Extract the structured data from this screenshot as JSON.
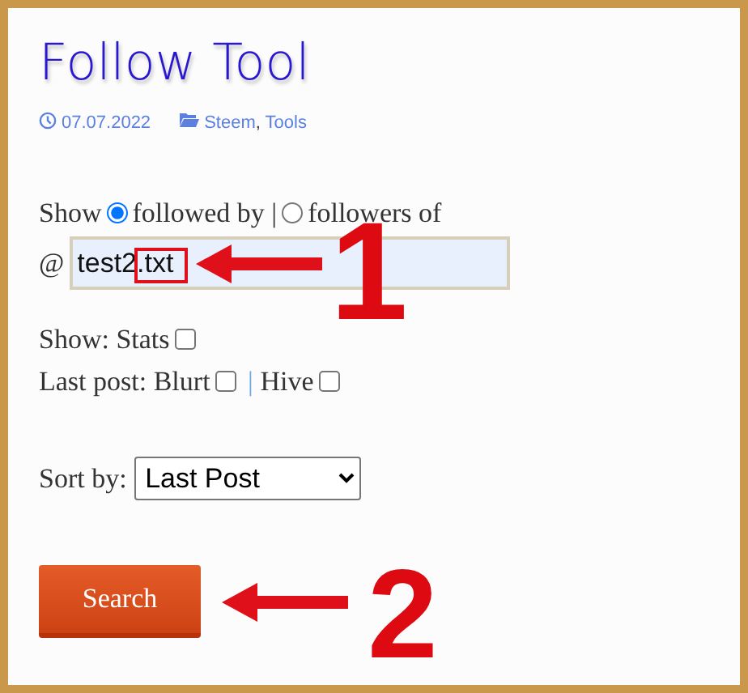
{
  "title": "Follow Tool",
  "meta": {
    "date": "07.07.2022",
    "categories": [
      "Steem",
      "Tools"
    ],
    "category_separator": ","
  },
  "form": {
    "show_label": "Show",
    "modes": [
      {
        "label": "followed by",
        "selected": true
      },
      {
        "label": "followers of",
        "selected": false
      }
    ],
    "mode_separator": "|",
    "at_sign": "@",
    "account": "test2.txt",
    "stats": {
      "label": "Show: Stats",
      "checked": false
    },
    "last_post": {
      "label": "Last post:",
      "options": [
        {
          "label": "Blurt",
          "checked": false
        },
        {
          "label": "Hive",
          "checked": false
        }
      ],
      "separator": "|"
    },
    "sort": {
      "label": "Sort by:",
      "value": "Last Post"
    },
    "search_button": "Search"
  },
  "annotations": [
    {
      "number": "1",
      "highlight": true
    },
    {
      "number": "2",
      "highlight": false
    }
  ]
}
